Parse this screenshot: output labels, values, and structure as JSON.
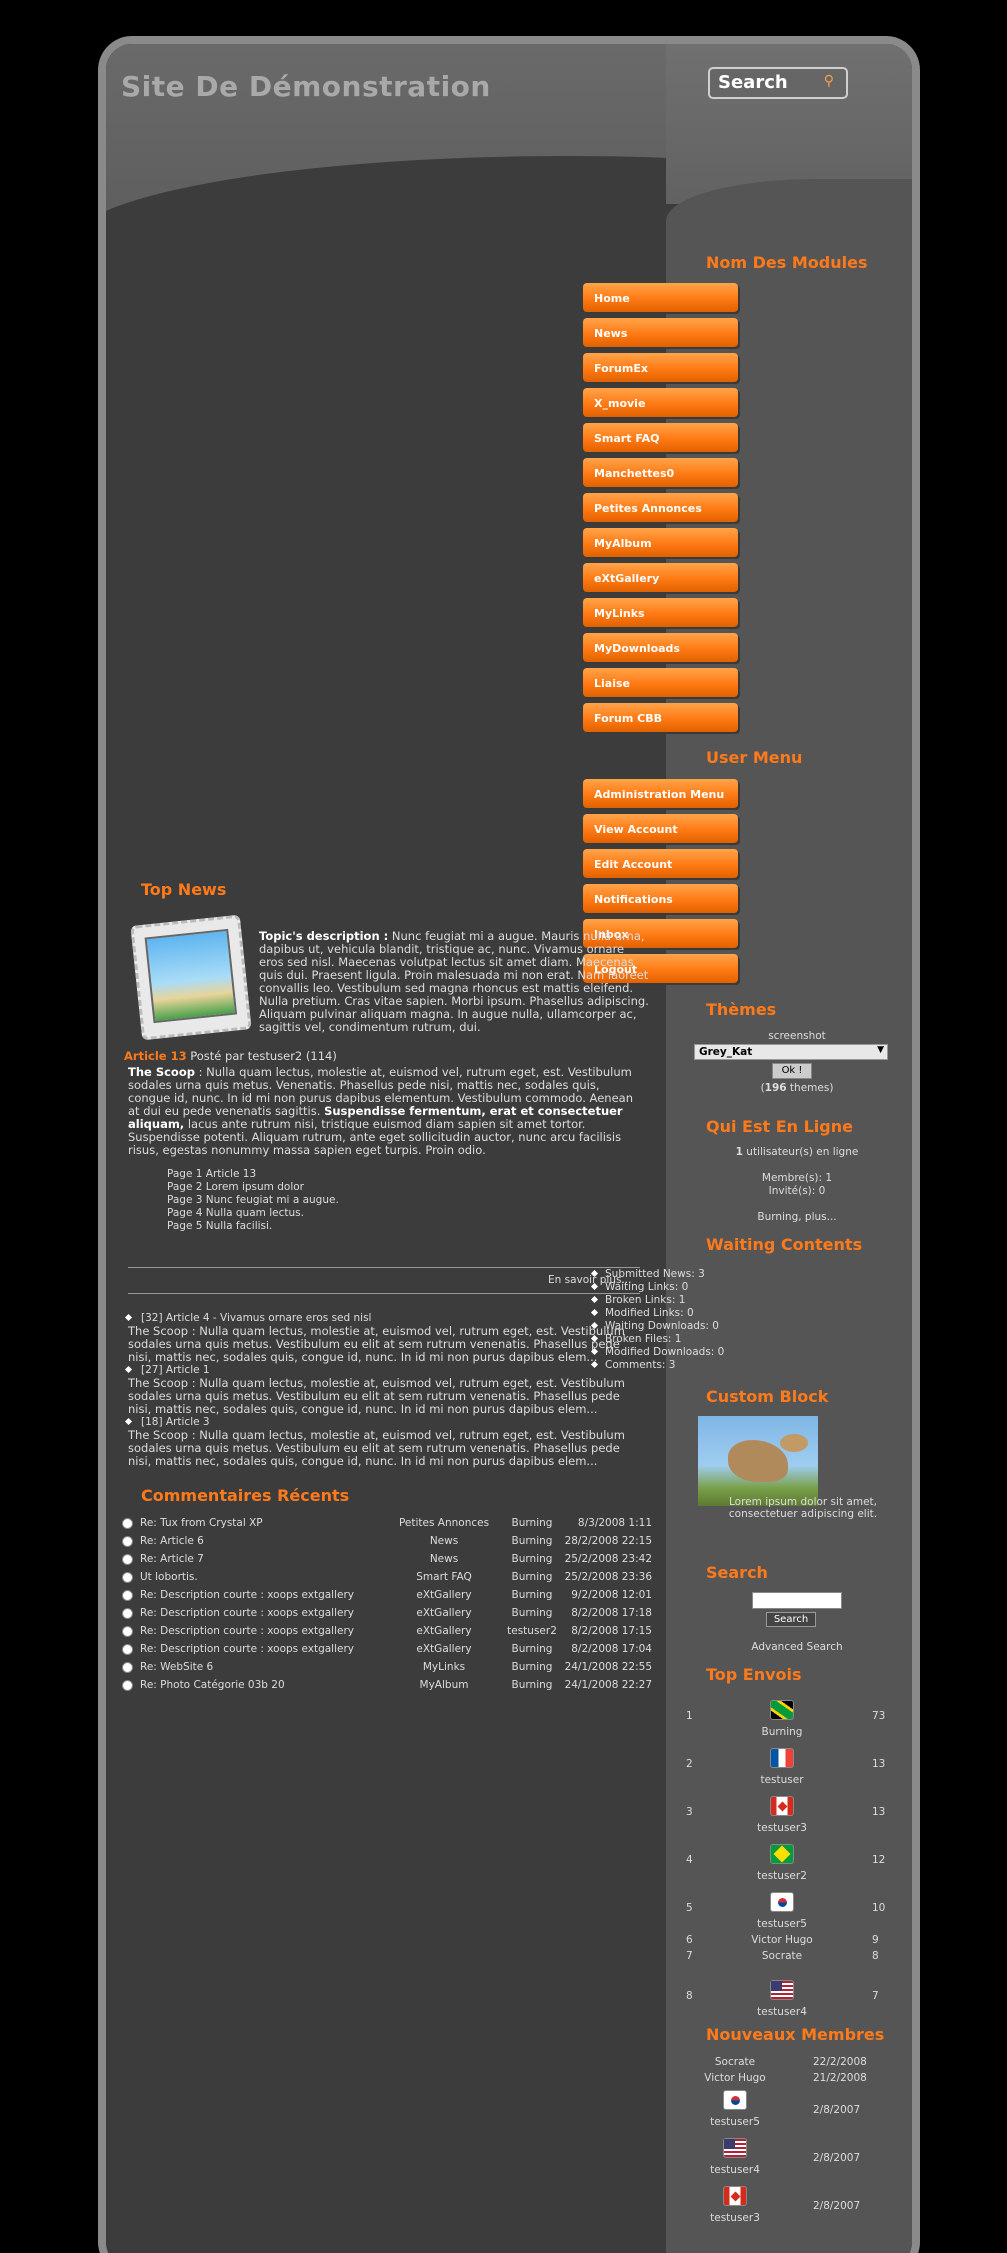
{
  "site_title": "Site De Démonstration",
  "search_box": {
    "label": "Search"
  },
  "modules": {
    "title": "Nom Des Modules",
    "items": [
      "Home",
      "News",
      "ForumEx",
      "X_movie",
      "Smart FAQ",
      "Manchettes0",
      "Petites Annonces",
      "MyAlbum",
      "eXtGallery",
      "MyLinks",
      "MyDownloads",
      "Liaise",
      "Forum CBB"
    ]
  },
  "user_menu": {
    "title": "User Menu",
    "items": [
      "Administration Menu",
      "View Account",
      "Edit Account",
      "Notifications",
      "Inbox",
      "Logout"
    ]
  },
  "themes": {
    "title": "Thèmes",
    "caption": "screenshot",
    "selected": "Grey_Kat",
    "ok": "Ok !",
    "count_open": "(",
    "count": "196",
    "count_suffix": " themes)"
  },
  "online": {
    "title": "Qui Est En Ligne",
    "count": "1",
    "count_suffix": " utilisateur(s) en ligne",
    "members": "Membre(s): 1",
    "guests": "Invité(s): 0",
    "names": "Burning, plus..."
  },
  "waiting": {
    "title": "Waiting Contents",
    "items": [
      "Submitted News: 3",
      "Waiting Links: 0",
      "Broken Links: 1",
      "Modified Links: 0",
      "Waiting Downloads: 0",
      "Broken Files: 1",
      "Modified Downloads: 0",
      "Comments: 3"
    ]
  },
  "custom_block": {
    "title": "Custom Block",
    "text": "Lorem ipsum dolor sit amet, consectetuer adipiscing elit."
  },
  "search_block": {
    "title": "Search",
    "button": "Search",
    "advanced": "Advanced Search"
  },
  "top_posters": {
    "title": "Top Envois",
    "rows": [
      {
        "rank": "1",
        "name": "Burning",
        "count": "73",
        "flag": "jm"
      },
      {
        "rank": "2",
        "name": "testuser",
        "count": "13",
        "flag": "fr"
      },
      {
        "rank": "3",
        "name": "testuser3",
        "count": "13",
        "flag": "ca"
      },
      {
        "rank": "4",
        "name": "testuser2",
        "count": "12",
        "flag": "br"
      },
      {
        "rank": "5",
        "name": "testuser5",
        "count": "10",
        "flag": "kr"
      },
      {
        "rank": "6",
        "name": "Victor Hugo",
        "count": "9",
        "flag": ""
      },
      {
        "rank": "7",
        "name": "Socrate",
        "count": "8",
        "flag": ""
      },
      {
        "rank": "8",
        "name": "testuser4",
        "count": "7",
        "flag": "us"
      }
    ]
  },
  "new_members": {
    "title": "Nouveaux Membres",
    "rows": [
      {
        "name": "Socrate",
        "date": "22/2/2008",
        "flag": ""
      },
      {
        "name": "Victor Hugo",
        "date": "21/2/2008",
        "flag": ""
      },
      {
        "name": "testuser5",
        "date": "2/8/2007",
        "flag": "kr"
      },
      {
        "name": "testuser4",
        "date": "2/8/2007",
        "flag": "us"
      },
      {
        "name": "testuser3",
        "date": "2/8/2007",
        "flag": "ca"
      }
    ]
  },
  "top_news": {
    "title": "Top News",
    "topic_label": "Topic's description :",
    "topic_text": " Nunc feugiat mi a augue. Mauris nulla urna, dapibus ut, vehicula blandit, tristique ac, nunc. Vivamus ornare eros sed nisl. Maecenas volutpat lectus sit amet diam. Maecenas quis dui. Praesent ligula. Proin malesuada mi non erat. Nam laoreet convallis leo. Vestibulum sed magna rhoncus est mattis eleifend. Nulla pretium. Cras vitae sapien. Morbi ipsum. Phasellus adipiscing. Aliquam pulvinar aliquam magna. In augue nulla, ullamcorper ac, sagittis vel, condimentum rutrum, dui.",
    "article_title": "Article 13",
    "article_meta": " Posté par testuser2 (114)",
    "scoop_label": "The Scoop",
    "scoop_text": " : Nulla quam lectus, molestie at, euismod vel, rutrum eget, est. Vestibulum sodales urna quis metus. Venenatis. Phasellus pede nisi, mattis nec, sodales quis, congue id, nunc. In id mi non purus dapibus elementum. Vestibulum commodo. Aenean at dui eu pede venenatis sagittis. ",
    "scoop_bold": "Suspendisse fermentum, erat et consectetuer aliquam,",
    "scoop_tail": " lacus ante rutrum nisi, tristique euismod diam sapien sit amet tortor. Suspendisse potenti. Aliquam rutrum, ante eget sollicitudin auctor, nunc arcu facilisis risus, egestas nonummy massa sapien eget turpis. Proin odio.",
    "pages": [
      "Page 1 Article 13",
      "Page 2 Lorem ipsum dolor",
      "Page 3 Nunc feugiat mi a augue.",
      "Page 4 Nulla quam lectus.",
      "Page 5 Nulla facilisi."
    ],
    "read_more": "En savoir plus...",
    "others": [
      {
        "title": "[32] Article 4 - Vivamus ornare eros sed nisl",
        "text": "The Scoop : Nulla quam lectus, molestie at, euismod vel, rutrum eget, est. Vestibulum sodales urna quis metus. Vestibulum eu elit at sem rutrum venenatis. Phasellus pede nisi, mattis nec, sodales quis, congue id, nunc. In id mi non purus dapibus elem..."
      },
      {
        "title": "[27] Article 1",
        "text": "The Scoop : Nulla quam lectus, molestie at, euismod vel, rutrum eget, est. Vestibulum sodales urna quis metus. Vestibulum eu elit at sem rutrum venenatis. Phasellus pede nisi, mattis nec, sodales quis, congue id, nunc. In id mi non purus dapibus elem..."
      },
      {
        "title": "[18] Article 3",
        "text": "The Scoop : Nulla quam lectus, molestie at, euismod vel, rutrum eget, est. Vestibulum sodales urna quis metus. Vestibulum eu elit at sem rutrum venenatis. Phasellus pede nisi, mattis nec, sodales quis, congue id, nunc. In id mi non purus dapibus elem..."
      }
    ]
  },
  "recent_comments": {
    "title": "Commentaires Récents",
    "rows": [
      {
        "title": "Re: Tux from Crystal XP",
        "module": "Petites Annonces",
        "user": "Burning",
        "date": "8/3/2008 1:11"
      },
      {
        "title": "Re: Article 6",
        "module": "News",
        "user": "Burning",
        "date": "28/2/2008 22:15"
      },
      {
        "title": "Re: Article 7",
        "module": "News",
        "user": "Burning",
        "date": "25/2/2008 23:42"
      },
      {
        "title": "Ut lobortis.",
        "module": "Smart FAQ",
        "user": "Burning",
        "date": "25/2/2008 23:36"
      },
      {
        "title": "Re: Description courte : xoops extgallery",
        "module": "eXtGallery",
        "user": "Burning",
        "date": "9/2/2008 12:01"
      },
      {
        "title": "Re: Description courte : xoops extgallery",
        "module": "eXtGallery",
        "user": "Burning",
        "date": "8/2/2008 17:18"
      },
      {
        "title": "Re: Description courte : xoops extgallery",
        "module": "eXtGallery",
        "user": "testuser2",
        "date": "8/2/2008 17:15"
      },
      {
        "title": "Re: Description courte : xoops extgallery",
        "module": "eXtGallery",
        "user": "Burning",
        "date": "8/2/2008 17:04"
      },
      {
        "title": "Re: WebSite 6",
        "module": "MyLinks",
        "user": "Burning",
        "date": "24/1/2008 22:55"
      },
      {
        "title": "Re: Photo Catégorie 03b 20",
        "module": "MyAlbum",
        "user": "Burning",
        "date": "24/1/2008 22:27"
      }
    ]
  }
}
